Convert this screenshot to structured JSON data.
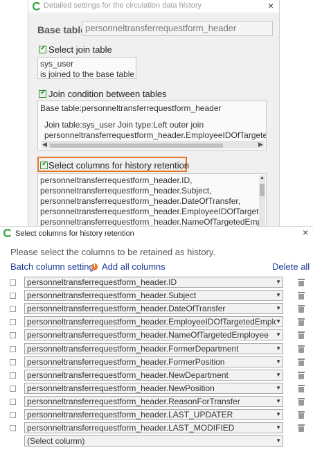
{
  "top_dialog": {
    "title": "Detailed settings for the circulation data history",
    "close_glyph": "×",
    "base_table_label": "Base table",
    "base_table_value": "personneltransferrequestform_header",
    "join_table": {
      "label": "Select join table",
      "lines": [
        "sys_user",
        "is joined to the base table"
      ]
    },
    "join_condition": {
      "label": "Join condition between tables",
      "header": "Base table:personneltransferrequestform_header",
      "lines": [
        "Join table:sys_user    Join type:Left outer join",
        "personneltransferrequestform_header.EmployeeIDOfTargeted"
      ]
    },
    "select_columns": {
      "label": "Select columns for history retention",
      "lines": [
        "personneltransferrequestform_header.ID,",
        "personneltransferrequestform_header.Subject,",
        "personneltransferrequestform_header.DateOfTransfer,",
        "personneltransferrequestform_header.EmployeeIDOfTarget",
        "personneltransferrequestform_header.NameOfTargetedEmp"
      ]
    },
    "highlight_color": "#e8762c"
  },
  "bottom_dialog": {
    "title": "Select columns for history retention",
    "close_glyph": "×",
    "instruction": "Please select the columns to be retained as history.",
    "batch_column_setting": "Batch column setting",
    "add_all_columns": "Add all columns",
    "delete_all": "Delete all",
    "info_glyph": "!",
    "rows": [
      "personneltransferrequestform_header.ID",
      "personneltransferrequestform_header.Subject",
      "personneltransferrequestform_header.DateOfTransfer",
      "personneltransferrequestform_header.EmployeeIDOfTargetedEmplo",
      "personneltransferrequestform_header.NameOfTargetedEmployee",
      "personneltransferrequestform_header.FormerDepartment",
      "personneltransferrequestform_header.FormerPosition",
      "personneltransferrequestform_header.NewDepartment",
      "personneltransferrequestform_header.NewPosition",
      "personneltransferrequestform_header.ReasonForTransfer",
      "personneltransferrequestform_header.LAST_UPDATER",
      "personneltransferrequestform_header.LAST_MODIFIED"
    ],
    "empty_row": "(Select column)",
    "link_color": "#1a3a9a"
  }
}
